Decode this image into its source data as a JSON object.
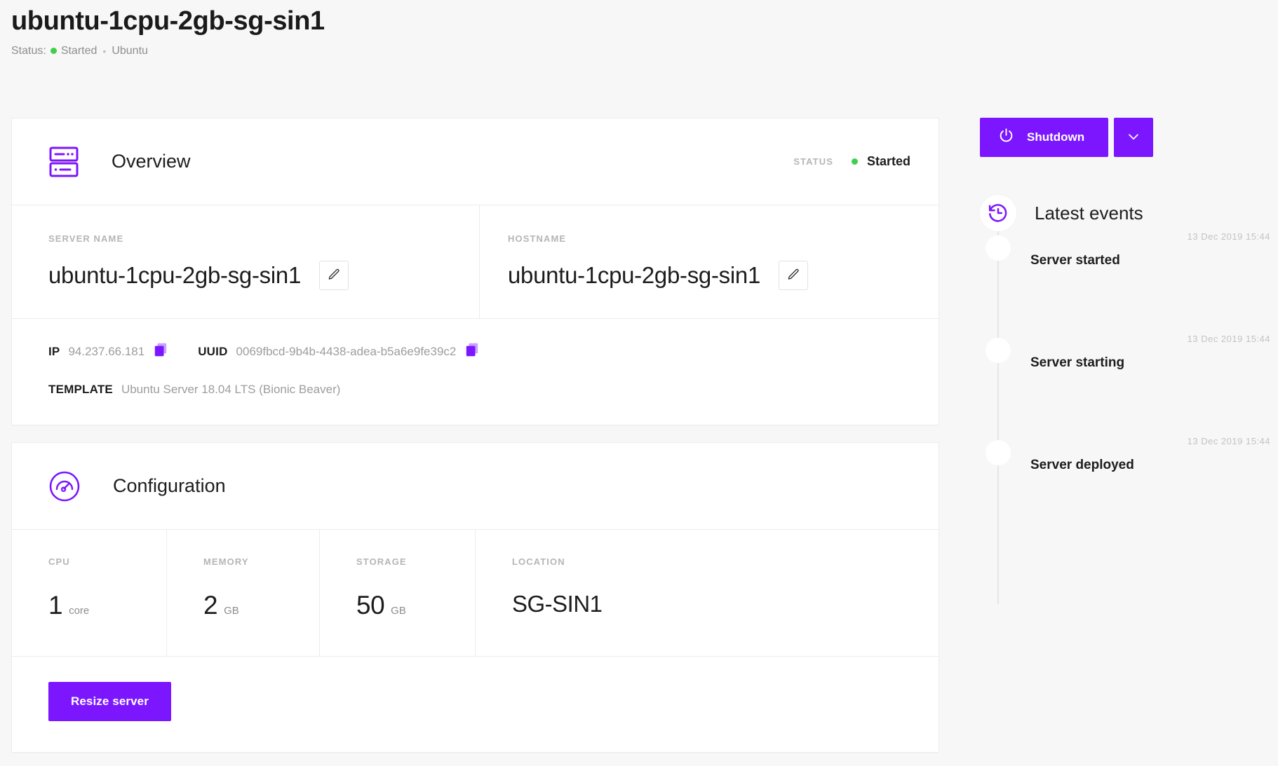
{
  "page": {
    "title": "ubuntu-1cpu-2gb-sg-sin1",
    "status_prefix": "Status:",
    "status_value": "Started",
    "separator": "•",
    "os": "Ubuntu"
  },
  "overview": {
    "heading": "Overview",
    "icon": "server-rack-icon",
    "status_label": "STATUS",
    "status_value": "Started",
    "fields": [
      {
        "label": "SERVER NAME",
        "value": "ubuntu-1cpu-2gb-sg-sin1",
        "edit_icon": "pencil-icon"
      },
      {
        "label": "HOSTNAME",
        "value": "ubuntu-1cpu-2gb-sg-sin1",
        "edit_icon": "pencil-icon"
      }
    ],
    "meta": {
      "ip_key": "IP",
      "ip_value": "94.237.66.181",
      "uuid_key": "UUID",
      "uuid_value": "0069fbcd-9b4b-4438-adea-b5a6e9fe39c2",
      "template_key": "TEMPLATE",
      "template_value": "Ubuntu Server 18.04 LTS (Bionic Beaver)",
      "copy_icon": "copy-icon"
    }
  },
  "configuration": {
    "heading": "Configuration",
    "icon": "gauge-icon",
    "specs": [
      {
        "label": "CPU",
        "value": "1",
        "unit": "core"
      },
      {
        "label": "MEMORY",
        "value": "2",
        "unit": "GB"
      },
      {
        "label": "STORAGE",
        "value": "50",
        "unit": "GB"
      },
      {
        "label": "LOCATION",
        "value": "SG-SIN1",
        "unit": ""
      }
    ],
    "resize_label": "Resize server"
  },
  "sidebar": {
    "shutdown_label": "Shutdown",
    "shutdown_icon": "power-icon",
    "caret_icon": "chevron-down-icon",
    "events_title": "Latest events",
    "events_icon": "history-clock-icon",
    "events": [
      {
        "time": "13 Dec 2019 15:44",
        "label": "Server started"
      },
      {
        "time": "13 Dec 2019 15:44",
        "label": "Server starting"
      },
      {
        "time": "13 Dec 2019 15:44",
        "label": "Server deployed"
      }
    ]
  },
  "colors": {
    "accent": "#7b16ff",
    "status_green": "#3ecf4c",
    "page_bg": "#f7f7f7",
    "card_bg": "#ffffff",
    "border": "#ececec"
  }
}
